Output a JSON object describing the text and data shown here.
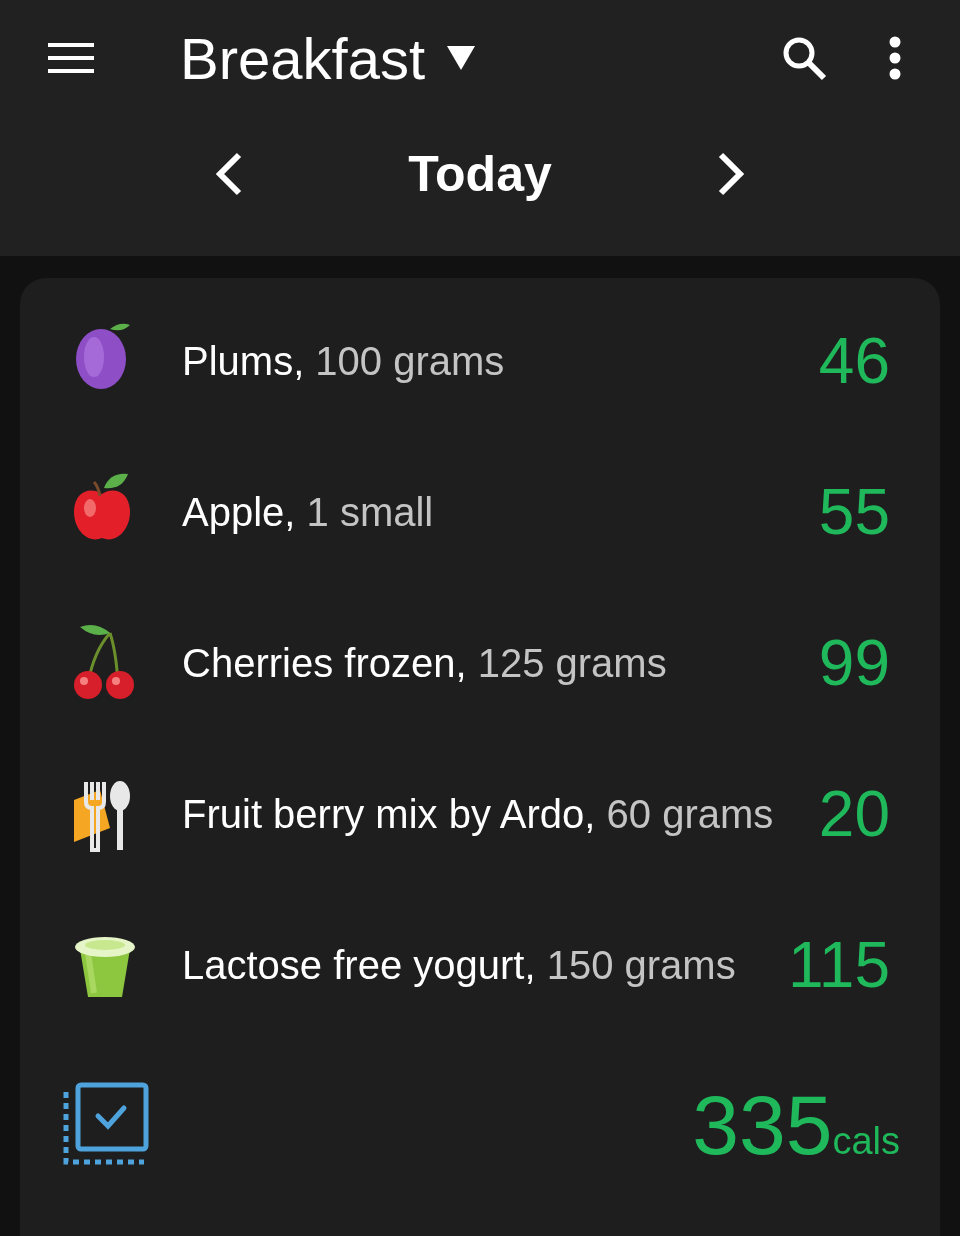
{
  "header": {
    "title": "Breakfast"
  },
  "date_nav": {
    "label": "Today"
  },
  "foods": [
    {
      "kind": "plum",
      "name": "Plums,",
      "portion": "100 grams",
      "calories": "46"
    },
    {
      "kind": "apple",
      "name": "Apple,",
      "portion": "1 small",
      "calories": "55"
    },
    {
      "kind": "cherries",
      "name": "Cherries frozen,",
      "portion": "125 grams",
      "calories": "99"
    },
    {
      "kind": "utensils",
      "name": "Fruit berry mix by Ardo,",
      "portion": "60 grams",
      "calories": "20"
    },
    {
      "kind": "yogurt",
      "name": "Lactose free yogurt,",
      "portion": "150 grams",
      "calories": "115"
    }
  ],
  "total": {
    "value": "335",
    "unit": "cals"
  }
}
